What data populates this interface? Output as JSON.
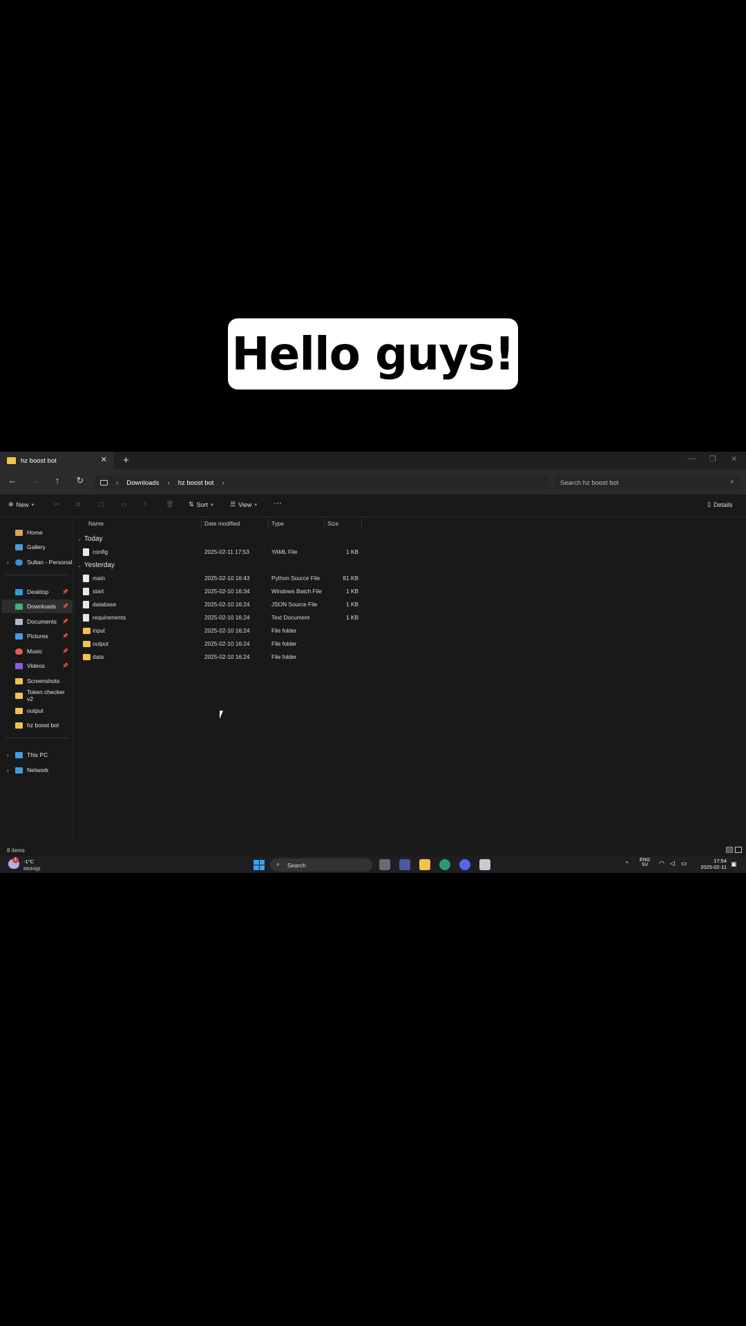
{
  "caption": {
    "text": "Hello guys!"
  },
  "window": {
    "tab_title": "hz boost bot",
    "breadcrumb": [
      "Downloads",
      "hz boost bot"
    ],
    "search_placeholder": "Search hz boost bot",
    "toolbar": {
      "new": "New",
      "sort": "Sort",
      "view": "View",
      "more": "···",
      "details": "Details"
    }
  },
  "sidebar": {
    "top": [
      {
        "label": "Home",
        "icon": "home-icon",
        "color": "#e0a060"
      },
      {
        "label": "Gallery",
        "icon": "gallery-icon",
        "color": "#4a9be0"
      },
      {
        "label": "Sultan - Personal",
        "icon": "cloud-icon",
        "color": "#3a8ee6"
      }
    ],
    "pinned": [
      {
        "label": "Desktop",
        "icon": "desktop-icon",
        "color": "#2aa0e0"
      },
      {
        "label": "Downloads",
        "icon": "download-icon",
        "color": "#37b37c"
      },
      {
        "label": "Documents",
        "icon": "document-icon",
        "color": "#b0b8c8"
      },
      {
        "label": "Pictures",
        "icon": "pictures-icon",
        "color": "#3f9ae8"
      },
      {
        "label": "Music",
        "icon": "music-icon",
        "color": "#e25c4a"
      },
      {
        "label": "Videos",
        "icon": "videos-icon",
        "color": "#8a5cd6"
      }
    ],
    "folders": [
      {
        "label": "Screenshots"
      },
      {
        "label": "Token checker v2"
      },
      {
        "label": "output"
      },
      {
        "label": "hz boost bot"
      }
    ],
    "bottom": [
      {
        "label": "This PC",
        "icon": "pc-icon",
        "color": "#3aa0e6"
      },
      {
        "label": "Network",
        "icon": "network-icon",
        "color": "#3aa0e6"
      }
    ]
  },
  "columns": {
    "name": "Name",
    "date": "Date modified",
    "type": "Type",
    "size": "Size"
  },
  "groups": [
    {
      "label": "Today",
      "files": [
        {
          "name": "config",
          "date": "2025-02-11 17:53",
          "type": "YAML File",
          "size": "1 KB",
          "kind": "doc"
        }
      ]
    },
    {
      "label": "Yesterday",
      "files": [
        {
          "name": "main",
          "date": "2025-02-10 16:43",
          "type": "Python Source File",
          "size": "81 KB",
          "kind": "doc"
        },
        {
          "name": "start",
          "date": "2025-02-10 16:34",
          "type": "Windows Batch File",
          "size": "1 KB",
          "kind": "doc"
        },
        {
          "name": "database",
          "date": "2025-02-10 16:24",
          "type": "JSON Source File",
          "size": "1 KB",
          "kind": "doc"
        },
        {
          "name": "requirements",
          "date": "2025-02-10 16:24",
          "type": "Text Document",
          "size": "1 KB",
          "kind": "doc"
        },
        {
          "name": "input",
          "date": "2025-02-10 16:24",
          "type": "File folder",
          "size": "",
          "kind": "folder"
        },
        {
          "name": "output",
          "date": "2025-02-10 16:24",
          "type": "File folder",
          "size": "",
          "kind": "folder"
        },
        {
          "name": "data",
          "date": "2025-02-10 16:24",
          "type": "File folder",
          "size": "",
          "kind": "folder"
        }
      ]
    }
  ],
  "status": {
    "items": "8 items"
  },
  "taskbar": {
    "weather_temp": "-1°C",
    "weather_desc": "Molnigt",
    "weather_badge": "1",
    "search": "Search",
    "lang_top": "ENG",
    "lang_bottom": "SV",
    "time": "17:54",
    "date": "2025-02-11"
  }
}
